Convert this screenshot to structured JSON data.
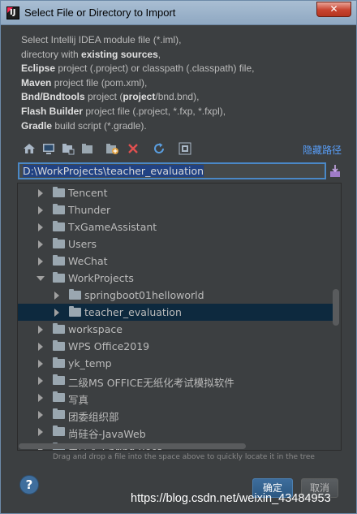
{
  "window": {
    "title": "Select File or Directory to Import",
    "close_glyph": "✕",
    "app_icon_text": "IJ"
  },
  "description": [
    {
      "parts": [
        {
          "t": "Select Intellij IDEA module file (*.iml),",
          "b": false
        }
      ]
    },
    {
      "parts": [
        {
          "t": "directory with ",
          "b": false
        },
        {
          "t": "existing sources",
          "b": true
        },
        {
          "t": ",",
          "b": false
        }
      ]
    },
    {
      "parts": [
        {
          "t": "Eclipse",
          "b": true
        },
        {
          "t": " project (.project) or classpath (.classpath) file,",
          "b": false
        }
      ]
    },
    {
      "parts": [
        {
          "t": "Maven",
          "b": true
        },
        {
          "t": " project file (pom.xml),",
          "b": false
        }
      ]
    },
    {
      "parts": [
        {
          "t": "Bnd/Bndtools",
          "b": true
        },
        {
          "t": " project (",
          "b": false
        },
        {
          "t": "project",
          "b": true
        },
        {
          "t": "/bnd.bnd),",
          "b": false
        }
      ]
    },
    {
      "parts": [
        {
          "t": "Flash Builder",
          "b": true
        },
        {
          "t": " project file (.project, *.fxp, *.fxpl),",
          "b": false
        }
      ]
    },
    {
      "parts": [
        {
          "t": "Gradle",
          "b": true
        },
        {
          "t": " build script (*.gradle).",
          "b": false
        }
      ]
    }
  ],
  "toolbar": {
    "icons": [
      "home-icon",
      "desktop-icon",
      "project-icon",
      "module-icon",
      "new-folder-icon",
      "delete-icon",
      "refresh-icon",
      "show-hidden-icon"
    ],
    "hide_path_label": "隐藏路径"
  },
  "path_input": {
    "value": "D:\\WorkProjects\\teacher_evaluation"
  },
  "tree": [
    {
      "label": "Tencent",
      "depth": 0,
      "expanded": false,
      "selected": false
    },
    {
      "label": "Thunder",
      "depth": 0,
      "expanded": false,
      "selected": false
    },
    {
      "label": "TxGameAssistant",
      "depth": 0,
      "expanded": false,
      "selected": false
    },
    {
      "label": "Users",
      "depth": 0,
      "expanded": false,
      "selected": false
    },
    {
      "label": "WeChat",
      "depth": 0,
      "expanded": false,
      "selected": false
    },
    {
      "label": "WorkProjects",
      "depth": 0,
      "expanded": true,
      "selected": false
    },
    {
      "label": "springboot01helloworld",
      "depth": 1,
      "expanded": false,
      "selected": false
    },
    {
      "label": "teacher_evaluation",
      "depth": 1,
      "expanded": false,
      "selected": true
    },
    {
      "label": "workspace",
      "depth": 0,
      "expanded": false,
      "selected": false
    },
    {
      "label": "WPS Office2019",
      "depth": 0,
      "expanded": false,
      "selected": false
    },
    {
      "label": "yk_temp",
      "depth": 0,
      "expanded": false,
      "selected": false
    },
    {
      "label": "二级MS OFFICE无纸化考试模拟软件",
      "depth": 0,
      "expanded": false,
      "selected": false
    },
    {
      "label": "写真",
      "depth": 0,
      "expanded": false,
      "selected": false
    },
    {
      "label": "团委组织部",
      "depth": 0,
      "expanded": false,
      "selected": false
    },
    {
      "label": "尚硅谷-JavaWeb",
      "depth": 0,
      "expanded": false,
      "selected": false
    },
    {
      "label": "尚硅谷-Spring Boot",
      "depth": 0,
      "expanded": false,
      "selected": false
    }
  ],
  "hint": "Drag and drop a file into the space above to quickly locate it in the tree",
  "buttons": {
    "help": "?",
    "ok": "确定",
    "cancel": "取消"
  },
  "watermark": "https://blog.csdn.net/weixin_43484953",
  "colors": {
    "background": "#3c3f41",
    "selection": "#0d293e",
    "link": "#589df6",
    "folder": "#9aa7b0"
  }
}
